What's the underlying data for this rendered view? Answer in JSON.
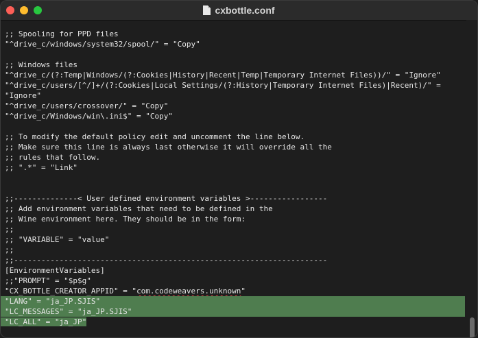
{
  "window": {
    "title": "cxbottle.conf",
    "icon": "document-icon"
  },
  "lines": [
    ";; Spooling for PPD files",
    "\"^drive_c/windows/system32/spool/\" = \"Copy\"",
    "",
    ";; Windows files",
    "\"^drive_c/(?:Temp|Windows/(?:Cookies|History|Recent|Temp|Temporary Internet Files))/\" = \"Ignore\"",
    "\"^drive_c/users/[^/]+/(?:Cookies|Local Settings/(?:History|Temporary Internet Files)|Recent)/\" =",
    "\"Ignore\"",
    "\"^drive_c/users/crossover/\" = \"Copy\"",
    "\"^drive_c/Windows/win\\.ini$\" = \"Copy\"",
    "",
    ";; To modify the default policy edit and uncomment the line below.",
    ";; Make sure this line is always last otherwise it will override all the",
    ";; rules that follow.",
    ";; \".*\" = \"Link\"",
    "",
    "",
    ";;--------------< User defined environment variables >-----------------",
    ";; Add environment variables that need to be defined in the",
    ";; Wine environment here. They should be in the form:",
    ";;",
    ";; \"VARIABLE\" = \"value\"",
    ";;",
    ";;---------------------------------------------------------------------",
    "[EnvironmentVariables]",
    ";;\"PROMPT\" = \"$p$g\""
  ],
  "appid_line": {
    "prefix": "\"CX_BOTTLE_CREATOR_APPID\" = \"",
    "squiggle": "com.codeweavers.unknown",
    "suffix": "\""
  },
  "selected_lines": [
    "\"LANG\" = \"ja_JP.SJIS\"",
    "\"LC_MESSAGES\" = \"ja_JP.SJIS\""
  ],
  "last_line": "\"LC_ALL\" = \"ja_JP\""
}
